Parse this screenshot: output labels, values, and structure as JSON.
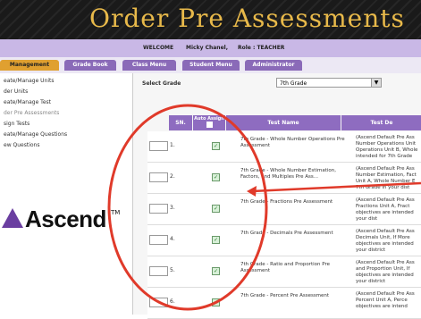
{
  "header": {
    "title": "Order Pre Assessments"
  },
  "welcome": {
    "welcome_label": "WELCOME",
    "user_name": "Micky Chanel,",
    "role_text": "Role : TEACHER"
  },
  "tabs": [
    {
      "label": "Management"
    },
    {
      "label": "Grade Book"
    },
    {
      "label": "Class Menu"
    },
    {
      "label": "Student Menu"
    },
    {
      "label": "Administrator"
    }
  ],
  "sidebar": {
    "items": [
      {
        "label": "eate/Manage Units"
      },
      {
        "label": "der Units"
      },
      {
        "label": "eate/Manage Test"
      },
      {
        "label": "der Pre Assessments"
      },
      {
        "label": "sign Tests"
      },
      {
        "label": "eate/Manage Questions"
      },
      {
        "label": "ew Questions"
      }
    ]
  },
  "logo": {
    "text": "Ascend",
    "tm": "TM"
  },
  "main": {
    "grade_label": "Select Grade",
    "grade_value": "7th Grade"
  },
  "table": {
    "headers": {
      "sn": "SN.",
      "auto_assign": "Auto Assign",
      "test_name": "Test Name",
      "test_desc": "Test De"
    },
    "rows": [
      {
        "num": "1.",
        "name": "7th Grade - Whole Number Operations Pre Assessment",
        "desc": "(Ascend Default Pre Ass Number Operations Unit Operations Unit B, Whole intended for 7th Grade"
      },
      {
        "num": "2.",
        "name": "7th Grade - Whole Number Estimation, Factors, and Multiples Pre Ass...",
        "desc": "(Ascend Default Pre Ass Number Estimation, Fact Unit A, Whole Number E 7th Grade in your dist"
      },
      {
        "num": "3.",
        "name": "7th Grade - Fractions Pre Assessment",
        "desc": "(Ascend Default Pre Ass Fractions Unit A, Fract objectives are intended your dist"
      },
      {
        "num": "4.",
        "name": "7th Grade - Decimals Pre Assessment",
        "desc": "(Ascend Default Pre Ass Decimals Unit, If More objectives are intended your district"
      },
      {
        "num": "5.",
        "name": "7th Grade - Ratio and Proportion Pre Assessment",
        "desc": "(Ascend Default Pre Ass and Proportion Unit, If objectives are intended your district"
      },
      {
        "num": "6.",
        "name": "7th Grade - Percent Pre Assessment",
        "desc": "(Ascend Default Pre Ass Percent Unit A, Perce objectives are intend"
      }
    ]
  },
  "colors": {
    "header_bg": "#1a1a1a",
    "title": "#e8b94a",
    "tab": "#8a6ab8",
    "tab_active": "#e0a030",
    "table_header": "#8e6cc0",
    "annotation": "#e03a2a"
  }
}
